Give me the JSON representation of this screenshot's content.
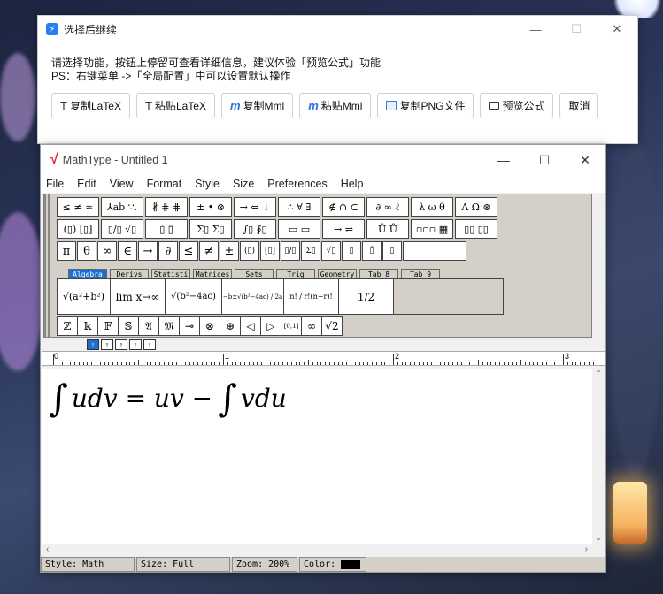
{
  "popup": {
    "title": "选择后继续",
    "line1": "请选择功能，按钮上停留可查看详细信息，建议体验「预览公式」功能",
    "line2": "PS：右键菜单 ->「全局配置」中可以设置默认操作",
    "buttons": [
      {
        "label": "复制LaTeX",
        "icon": "T"
      },
      {
        "label": "粘贴LaTeX",
        "icon": "T"
      },
      {
        "label": "复制Mml",
        "icon": "m"
      },
      {
        "label": "粘贴Mml",
        "icon": "m"
      },
      {
        "label": "复制PNG文件",
        "icon": "image"
      },
      {
        "label": "预览公式",
        "icon": "monitor"
      },
      {
        "label": "取消",
        "icon": ""
      }
    ]
  },
  "mathtype": {
    "title": "MathType - Untitled 1",
    "menu": [
      "File",
      "Edit",
      "View",
      "Format",
      "Style",
      "Size",
      "Preferences",
      "Help"
    ],
    "palette_row1": [
      "≤ ≠ ≈",
      "⅄ab ∵.",
      "∦ ⋕ ⋕",
      "± • ⊗",
      "→ ⇔ ↓",
      "∴ ∀ ∃",
      "∉ ∩ ⊂",
      "∂ ∞ ℓ",
      "λ ω θ",
      "Λ Ω ⊛"
    ],
    "palette_row2": [
      "(▯) [▯]",
      "▯/▯ √▯",
      "▯̇ ▯̂",
      "Σ▯ Σ▯",
      "∫▯ ∮▯",
      "▭ ▭",
      "→ ⇌",
      "Ū Ů",
      "▫▫▫ ▦",
      "▯▯ ▯▯"
    ],
    "palette_row3": [
      "π",
      "θ",
      "∞",
      "∈",
      "→",
      "∂",
      "≤",
      "≠",
      "±",
      "(▯)",
      "[▯]",
      "▯/▯",
      "Σ▯",
      "√▯",
      "▯̇",
      "▯̂",
      "▯̄"
    ],
    "tabs": [
      "Algebra",
      "Derivs",
      "Statisti",
      "Matrices",
      "Sets",
      "Trig",
      "Geometry",
      "Tab 8",
      "Tab 9"
    ],
    "templates": [
      "√(a²+b²)",
      "lim x→∞",
      "√(b²−4ac)",
      "−b±√(b²−4ac) / 2a",
      "n! / r!(n−r)!",
      "1/2"
    ],
    "symbols": [
      "ℤ",
      "𝕜",
      "𝔽",
      "𝕊",
      "𝔄",
      "𝔐",
      "⊸",
      "⊗",
      "⊕",
      "◁",
      "▷",
      "[0,1]",
      "∞",
      "√2"
    ],
    "ruler": [
      "0",
      "1",
      "2",
      "3"
    ],
    "formula": "∫ udv = uv − ∫ vdu",
    "status": {
      "style": "Style: Math",
      "size": "Size: Full",
      "zoom": "Zoom: 200%",
      "color": "Color:"
    }
  }
}
